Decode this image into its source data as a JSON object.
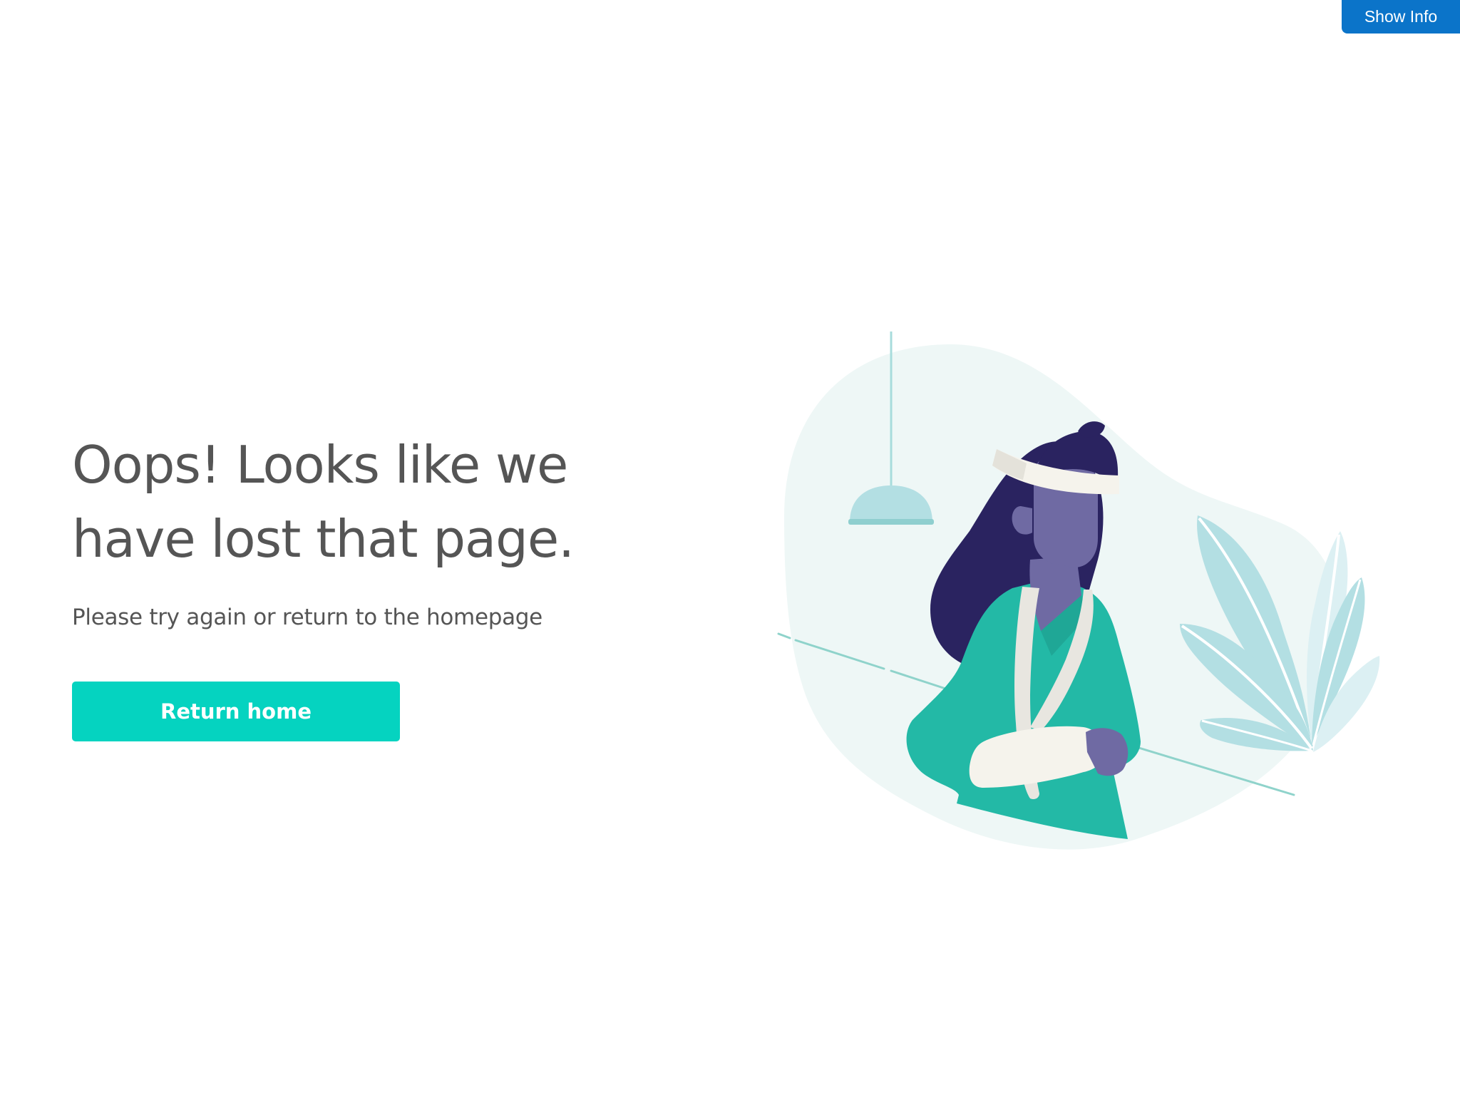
{
  "header": {
    "show_info_label": "Show Info"
  },
  "main": {
    "headline_line1": "Oops! Looks like we",
    "headline_line2": "have lost that page.",
    "subtext": "Please try again or return to the homepage",
    "return_button_label": "Return home"
  },
  "illustration": {
    "description_icon": "injured-person-illustration-icon"
  },
  "colors": {
    "accent": "#05d3c0",
    "info_button": "#0b74c9",
    "text": "#555555",
    "scrubs": "#23b9a6",
    "hair": "#2a2360",
    "skin": "#6f6aa3",
    "blob": "#eef7f6",
    "light_teal": "#b3dfe3"
  }
}
